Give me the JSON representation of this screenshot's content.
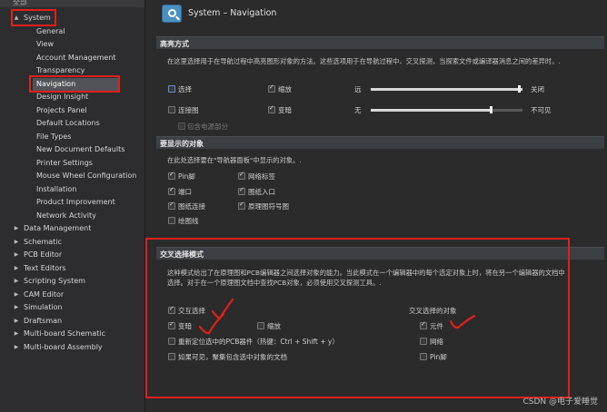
{
  "tree": {
    "top_label": "全部",
    "items": [
      {
        "label": "System",
        "arrow": "▲"
      },
      {
        "label": "General"
      },
      {
        "label": "View"
      },
      {
        "label": "Account Management"
      },
      {
        "label": "Transparency"
      },
      {
        "label": "Navigation"
      },
      {
        "label": "Design Insight"
      },
      {
        "label": "Projects Panel"
      },
      {
        "label": "Default Locations"
      },
      {
        "label": "File Types"
      },
      {
        "label": "New Document Defaults"
      },
      {
        "label": "Printer Settings"
      },
      {
        "label": "Mouse Wheel Configuration"
      },
      {
        "label": "Installation"
      },
      {
        "label": "Product Improvement"
      },
      {
        "label": "Network Activity"
      },
      {
        "label": "Data Management",
        "arrow": "▶"
      },
      {
        "label": "Schematic",
        "arrow": "▶"
      },
      {
        "label": "PCB Editor",
        "arrow": "▶"
      },
      {
        "label": "Text Editors",
        "arrow": "▶"
      },
      {
        "label": "Scripting System",
        "arrow": "▶"
      },
      {
        "label": "CAM Editor",
        "arrow": "▶"
      },
      {
        "label": "Simulation",
        "arrow": "▶"
      },
      {
        "label": "Draftsman",
        "arrow": "▶"
      },
      {
        "label": "Multi-board Schematic",
        "arrow": "▶"
      },
      {
        "label": "Multi-board Assembly",
        "arrow": "▶"
      }
    ]
  },
  "header": {
    "title": "System – Navigation"
  },
  "highlight": {
    "title": "高亮方式",
    "desc": "在这里选择用于在导航过程中高亮图形对象的方法。这些选项用于在导航过程中、交叉探测，当探索文件或编译器消息之间的差异时。.",
    "opt_select": "选择",
    "opt_zoom": "缩放",
    "opt_connect": "连接图",
    "opt_dim": "变暗",
    "opt_include_power": "包含电源部分",
    "slider1_left": "远",
    "slider1_right": "关闭",
    "slider1_value": 1.0,
    "slider2_left": "无",
    "slider2_right": "不可见",
    "slider2_value": 0.8
  },
  "objects": {
    "title": "要显示的对象",
    "desc": "在此处选择要在\"导航器面板\"中显示的对象。.",
    "items": [
      "Pin脚",
      "网络标签",
      "端口",
      "图纸入口",
      "图纸连接",
      "原理图符号图",
      "绘图线"
    ]
  },
  "cross": {
    "title": "交叉选择模式",
    "desc": "这种模式给出了在原理图和PCB编辑器之间选择对象的能力。当此模式在一个编辑器中的每个选定对象上时，将在另一个编辑器的文档中选择。对于在一个原理图文档中查找PCB对象，必须使用交叉探测工具。.",
    "opt_interactive": "交互选择",
    "opt_dim": "变暗",
    "opt_zoom": "缩放",
    "opt_reposition": "重新定位选中的PCB器件（热键：Ctrl + Shift + y）",
    "opt_visible": "如果可见，聚集包含选中对象的文档",
    "objects_title": "交叉选择的对象",
    "obj_component": "元件",
    "obj_net": "网络",
    "obj_pin": "Pin脚"
  },
  "watermark": "CSDN @电子爱睡觉",
  "colors": {
    "annotation_red": "#e0201b",
    "accent": "#4a90c2"
  }
}
